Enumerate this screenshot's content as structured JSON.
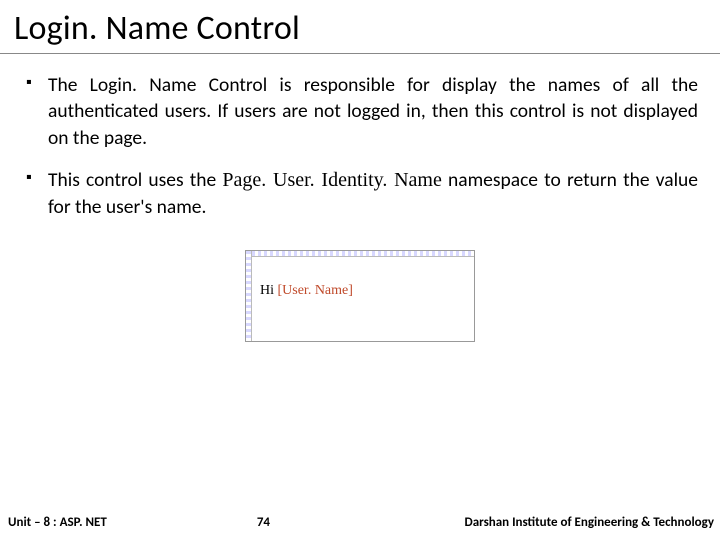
{
  "title": "Login. Name Control",
  "bullets": [
    {
      "text": "The Login. Name Control is responsible for display the names of all the authenticated users. If users are not logged in, then this control is not displayed on the page."
    },
    {
      "prefix": "This control uses the ",
      "code": "Page. User. Identity. Name",
      "suffix": " namespace to return the value for the user's name."
    }
  ],
  "figure": {
    "greeting": "Hi ",
    "placeholder": "[User. Name]"
  },
  "footer": {
    "unit": "Unit – 8 : ASP. NET",
    "page": "74",
    "org": "Darshan Institute of Engineering & Technology"
  }
}
